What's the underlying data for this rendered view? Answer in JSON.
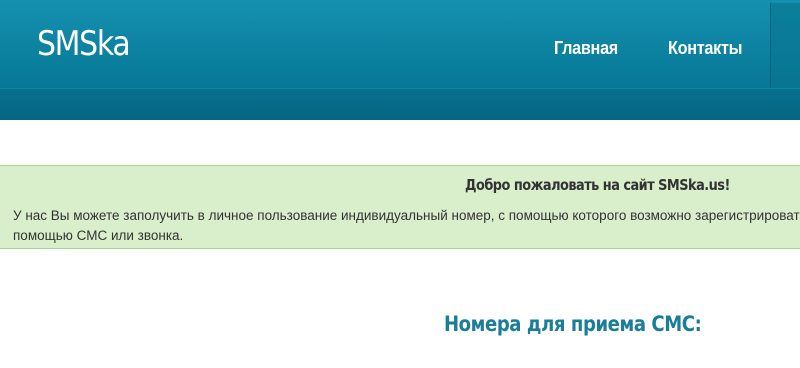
{
  "header": {
    "logo": "SMSka",
    "nav": {
      "home_label": "Главная",
      "contacts_label": "Контакты"
    }
  },
  "welcome": {
    "title": "Добро пожаловать на сайт SMSka.us!",
    "line1": "У нас Вы можете заполучить в личное пользование индивидуальный номер, с помощью которого возможно зарегистрироваться н",
    "line2": "помощью СМС или звонка."
  },
  "main": {
    "heading": "Номера для приема СМС:"
  },
  "colors": {
    "header": "#0a7d9c",
    "welcome_bg": "#d9eecb",
    "heading": "#1a7d9a"
  }
}
